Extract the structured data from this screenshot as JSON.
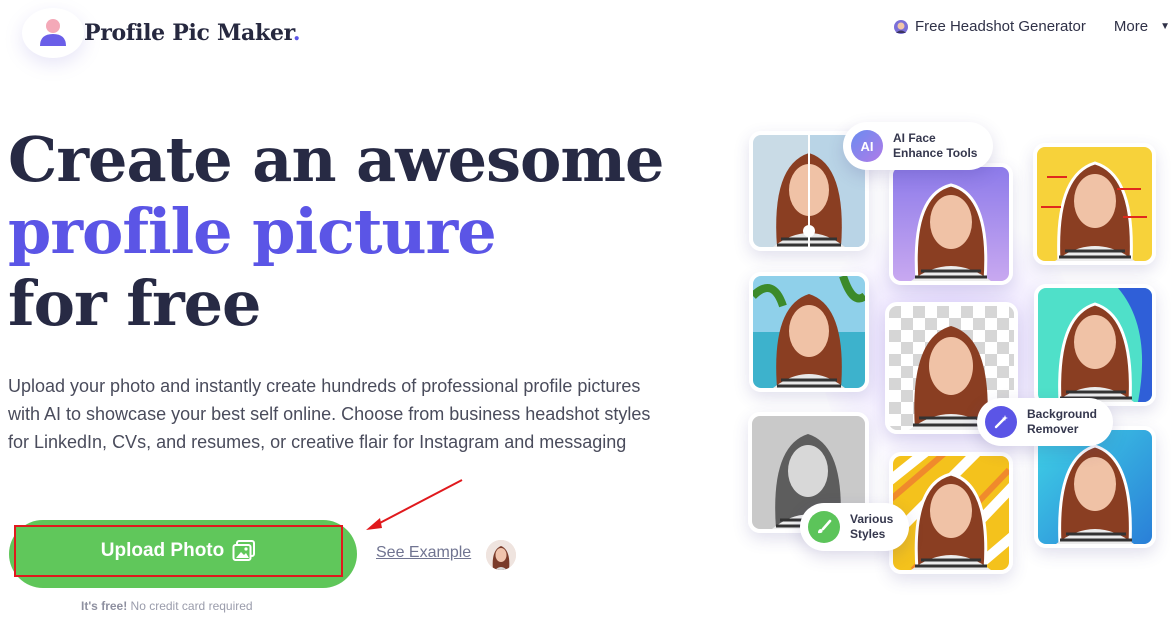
{
  "header": {
    "brand": "Profile Pic Maker",
    "brand_dot": ".",
    "nav": {
      "headshot_label": "Free Headshot Generator",
      "more_label": "More",
      "more_caret": "▼"
    }
  },
  "hero": {
    "title_line1": "Create an awesome",
    "title_line2": "profile picture",
    "title_line3": "for free",
    "description": "Upload your photo and instantly create hundreds of professional profile pictures with AI to showcase your best self online. Choose from business headshot styles for LinkedIn, CVs, and resumes, or creative flair for Instagram and messaging",
    "upload_label": "Upload Photo",
    "see_example_label": "See Example",
    "free_bold": "It's free!",
    "free_rest": " No credit card required"
  },
  "features": {
    "ai_badge": "AI",
    "ai_line1": "AI Face",
    "ai_line2": "Enhance Tools",
    "bg_line1": "Background",
    "bg_line2": "Remover",
    "styles_line1": "Various",
    "styles_line2": "Styles"
  },
  "colors": {
    "accent": "#5b55e6",
    "cta_green": "#60c75b",
    "highlight_red": "#e0191d",
    "heading": "#272a44"
  }
}
